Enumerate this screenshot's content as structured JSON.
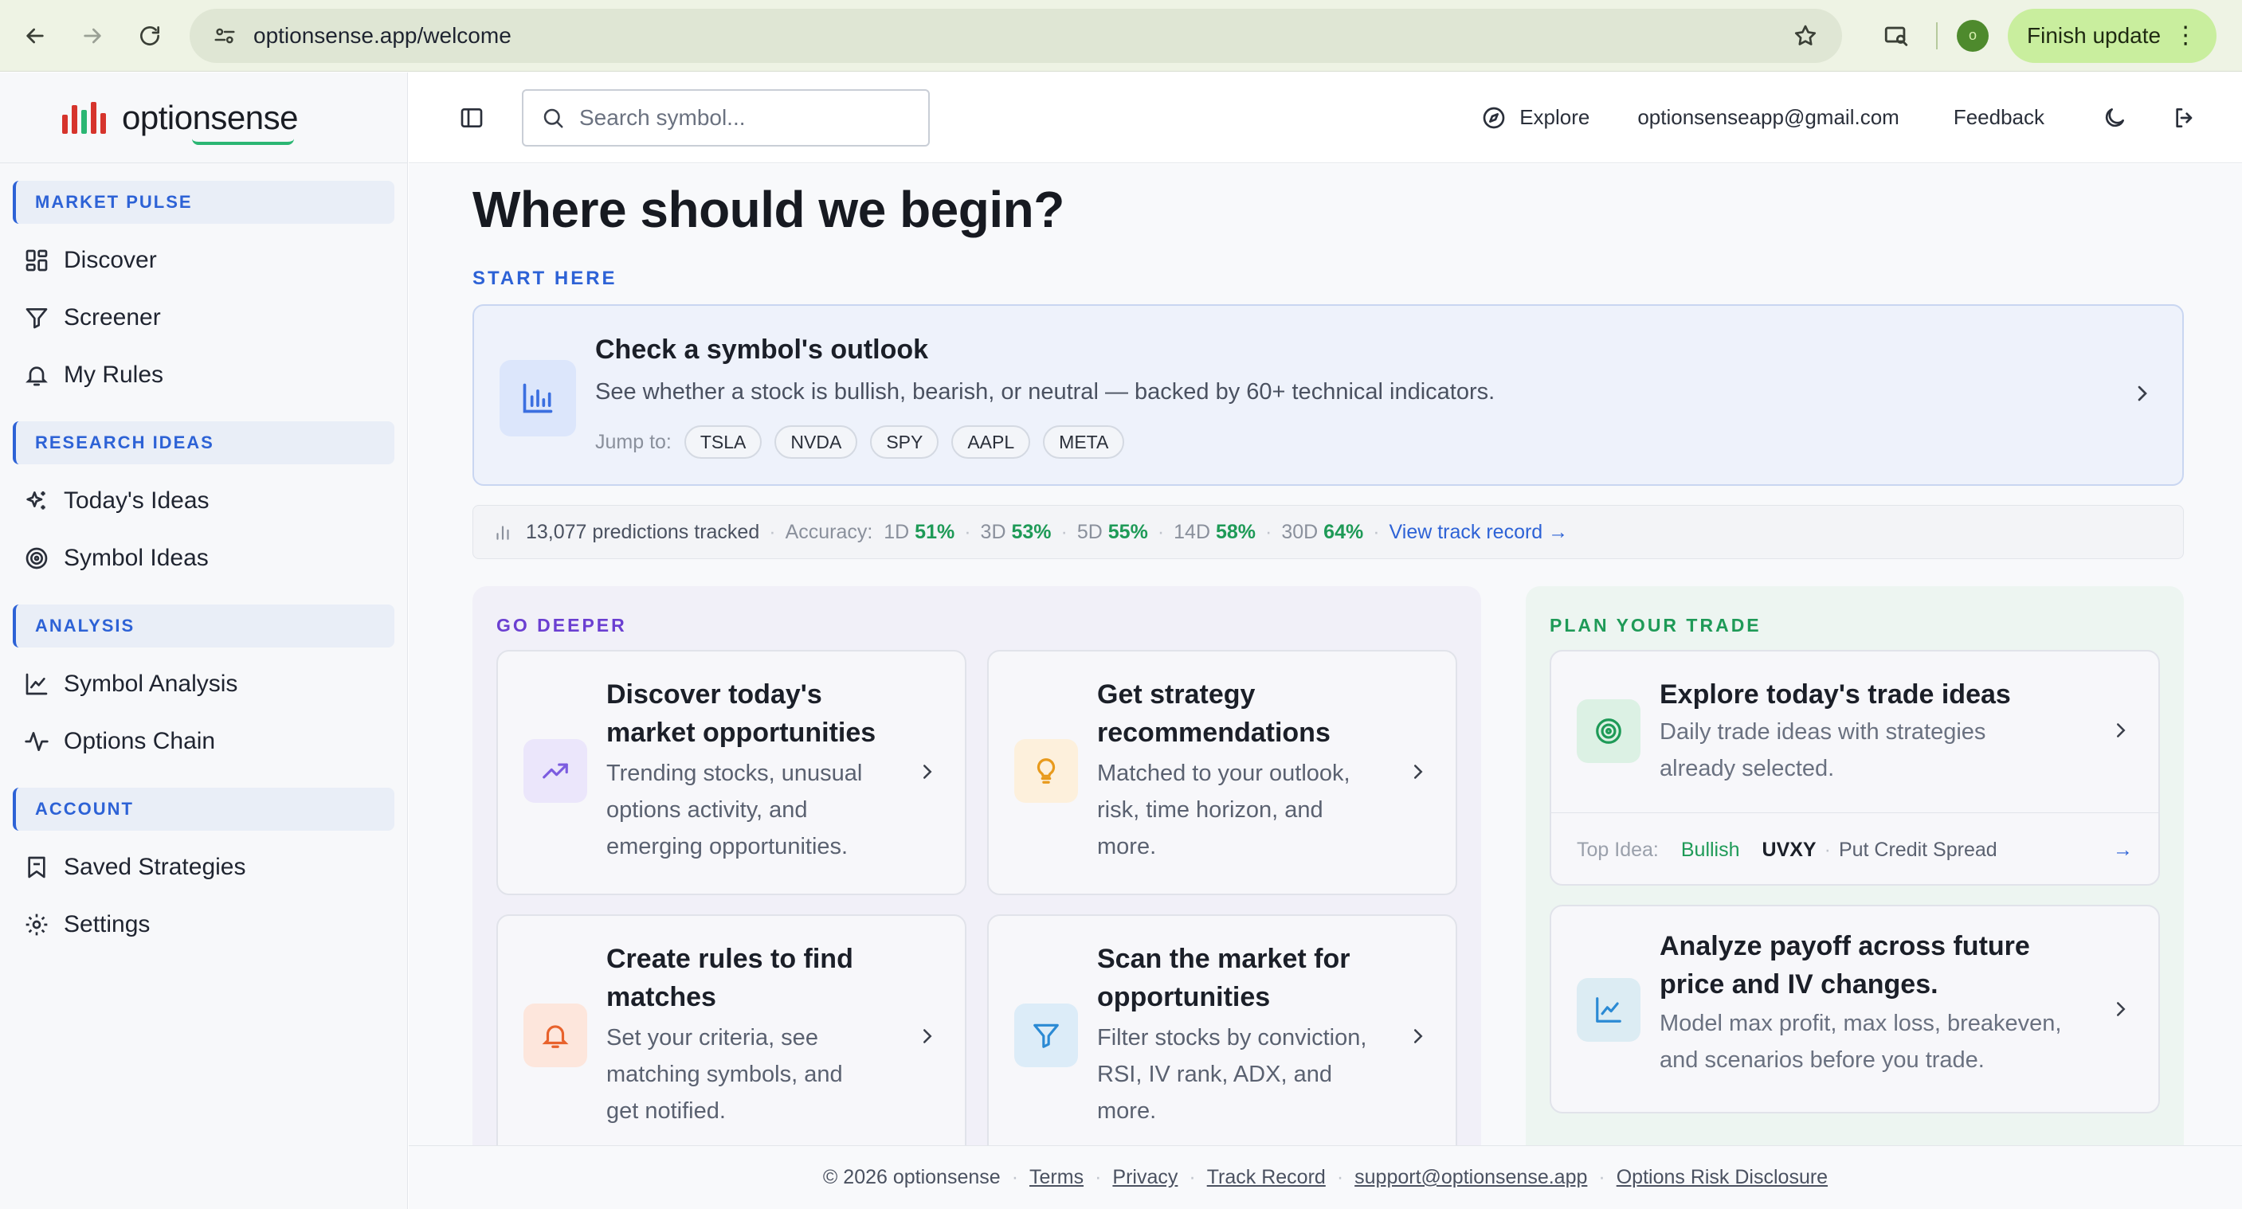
{
  "browser": {
    "url": "optionsense.app/welcome",
    "profile_initial": "o",
    "finish_update_label": "Finish update"
  },
  "sidebar": {
    "logo_text": "optionsense",
    "sections": [
      {
        "label": "MARKET PULSE",
        "items": [
          "Discover",
          "Screener",
          "My Rules"
        ]
      },
      {
        "label": "RESEARCH IDEAS",
        "items": [
          "Today's Ideas",
          "Symbol Ideas"
        ]
      },
      {
        "label": "ANALYSIS",
        "items": [
          "Symbol Analysis",
          "Options Chain"
        ]
      },
      {
        "label": "ACCOUNT",
        "items": [
          "Saved Strategies",
          "Settings"
        ]
      }
    ]
  },
  "topbar": {
    "search_placeholder": "Search symbol...",
    "explore_label": "Explore",
    "email": "optionsenseapp@gmail.com",
    "feedback_label": "Feedback"
  },
  "main": {
    "title": "Where should we begin?",
    "start_here_label": "START HERE",
    "outlook": {
      "title": "Check a symbol's outlook",
      "subtitle": "See whether a stock is bullish, bearish, or neutral — backed by 60+ technical indicators.",
      "jump_label": "Jump to:",
      "symbols": [
        "TSLA",
        "NVDA",
        "SPY",
        "AAPL",
        "META"
      ]
    },
    "stats": {
      "predictions": "13,077 predictions tracked",
      "accuracy_label": "Accuracy:",
      "horizons": [
        {
          "label": "1D",
          "value": "51%"
        },
        {
          "label": "3D",
          "value": "53%"
        },
        {
          "label": "5D",
          "value": "55%"
        },
        {
          "label": "14D",
          "value": "58%"
        },
        {
          "label": "30D",
          "value": "64%"
        }
      ],
      "track_link": "View track record →"
    },
    "go_deeper": {
      "label": "GO DEEPER",
      "cards": [
        {
          "title_1": "Discover today's",
          "title_2": "market opportunities",
          "desc_1": "Trending stocks, unusual",
          "desc_2": "options activity, and",
          "desc_3": "emerging opportunities."
        },
        {
          "title_1": "Get strategy",
          "title_2": "recommendations",
          "desc_1": "Matched to your outlook,",
          "desc_2": "risk, time horizon, and",
          "desc_3": "more."
        },
        {
          "title_1": "Create rules to find",
          "title_2": "matches",
          "desc_1": "Set your criteria, see",
          "desc_2": "matching symbols, and",
          "desc_3": "get notified."
        },
        {
          "title_1": "Scan the market for",
          "title_2": "opportunities",
          "desc_1": "Filter stocks by conviction,",
          "desc_2": "RSI, IV rank, ADX, and",
          "desc_3": "more."
        }
      ]
    },
    "plan_trade": {
      "label": "PLAN YOUR TRADE",
      "ideas_card": {
        "title": "Explore today's trade ideas",
        "desc_1": "Daily trade ideas with strategies",
        "desc_2": "already selected.",
        "top_idea_label": "Top Idea:",
        "top_idea_bias": "Bullish",
        "top_idea_symbol": "UVXY",
        "top_idea_strategy": "Put Credit Spread"
      },
      "payoff_card": {
        "title_1": "Analyze payoff across future",
        "title_2": "price and IV changes.",
        "desc_1": "Model max profit, max loss, breakeven,",
        "desc_2": "and scenarios before you trade."
      }
    }
  },
  "footer": {
    "copyright": "© 2026 optionsense",
    "links": [
      "Terms",
      "Privacy",
      "Track Record",
      "support@optionsense.app",
      "Options Risk Disclosure"
    ]
  },
  "colors": {
    "accent_blue": "#2d62d6",
    "accent_purple": "#6b3fd1",
    "accent_green": "#1e9a57",
    "chrome_green": "#c9ee9e"
  },
  "icons": {
    "browser": [
      "back-arrow-icon",
      "forward-arrow-icon",
      "reload-icon",
      "site-settings-icon",
      "bookmark-star-icon",
      "lens-search-icon",
      "kebab-menu-icon"
    ],
    "sidebar": [
      "grid-icon",
      "filter-funnel-icon",
      "bell-icon",
      "sparkles-icon",
      "target-icon",
      "line-chart-icon",
      "activity-pulse-icon",
      "bookmark-icon",
      "gear-icon"
    ],
    "topbar": [
      "sidebar-panel-icon",
      "search-icon",
      "compass-icon",
      "moon-icon",
      "logout-icon"
    ]
  }
}
